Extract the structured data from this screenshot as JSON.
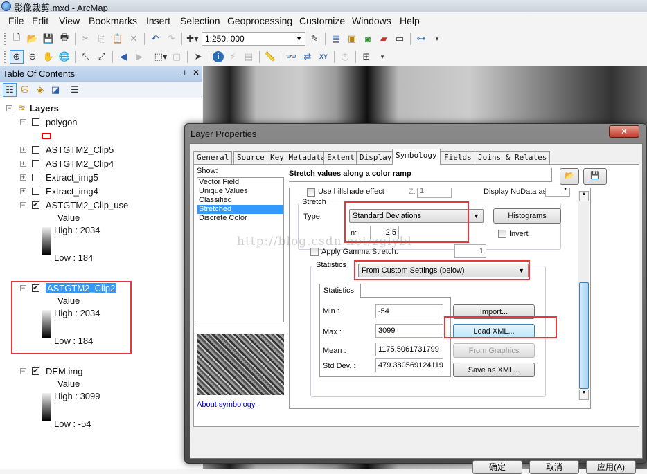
{
  "window": {
    "title": "影像裁剪.mxd - ArcMap"
  },
  "menu": [
    "File",
    "Edit",
    "View",
    "Bookmarks",
    "Insert",
    "Selection",
    "Geoprocessing",
    "Customize",
    "Windows",
    "Help"
  ],
  "toolbar": {
    "scale_value": "1:250, 000"
  },
  "toc": {
    "title": "Table Of Contents",
    "root": "Layers",
    "layers": [
      {
        "name": "polygon",
        "checked": false,
        "expand": "-"
      },
      {
        "name": "ASTGTM2_Clip5",
        "checked": false,
        "expand": "+"
      },
      {
        "name": "ASTGTM2_Clip4",
        "checked": false,
        "expand": "+"
      },
      {
        "name": "Extract_img5",
        "checked": false,
        "expand": "+"
      },
      {
        "name": "Extract_img4",
        "checked": false,
        "expand": "+"
      },
      {
        "name": "ASTGTM2_Clip_use",
        "checked": true,
        "expand": "-",
        "legend_title": "Value",
        "high": "High : 2034",
        "low": "Low : 184"
      },
      {
        "name": "ASTGTM2_Clip2",
        "checked": true,
        "expand": "-",
        "selected": true,
        "legend_title": "Value",
        "high": "High : 2034",
        "low": "Low : 184"
      },
      {
        "name": "DEM.img",
        "checked": true,
        "expand": "-",
        "legend_title": "Value",
        "high": "High : 3099",
        "low": "Low : -54"
      }
    ]
  },
  "dialog": {
    "title": "Layer Properties",
    "tabs": [
      "General",
      "Source",
      "Key Metadata",
      "Extent",
      "Display",
      "Symbology",
      "Fields",
      "Joins & Relates"
    ],
    "active_tab": "Symbology",
    "show_label": "Show:",
    "show_items": [
      "Vector Field",
      "Unique Values",
      "Classified",
      "Stretched",
      "Discrete Color"
    ],
    "show_selected": "Stretched",
    "about_link": "About symbology",
    "heading": "Stretch values along a color ramp",
    "hillshade_label": "Use hillshade effect",
    "hillshade_z_label": "Z:",
    "hillshade_z": "1",
    "nodata_label": "Display NoData as",
    "stretch_group": "Stretch",
    "type_label": "Type:",
    "type_value": "Standard Deviations",
    "histograms_label": "Histograms",
    "n_label": "n:",
    "n_value": "2.5",
    "invert_label": "Invert",
    "gamma_label": "Apply Gamma Stretch:",
    "gamma_value": "1",
    "statistics_group": "Statistics",
    "statistics_value": "From Custom Settings (below)",
    "stats_tab": "Statistics",
    "min_label": "Min :",
    "min_value": "-54",
    "max_label": "Max :",
    "max_value": "3099",
    "mean_label": "Mean :",
    "mean_value": "1175.5061731799",
    "std_label": "Std Dev. :",
    "std_value": "479.380569124119",
    "import_label": "Import...",
    "load_xml_label": "Load XML...",
    "from_graphics_label": "From Graphics",
    "save_xml_label": "Save as XML...",
    "ok_label": "确定",
    "cancel_label": "取消",
    "apply_label": "应用(A)"
  },
  "watermark": "http://blog.csdn.net/zglybl"
}
